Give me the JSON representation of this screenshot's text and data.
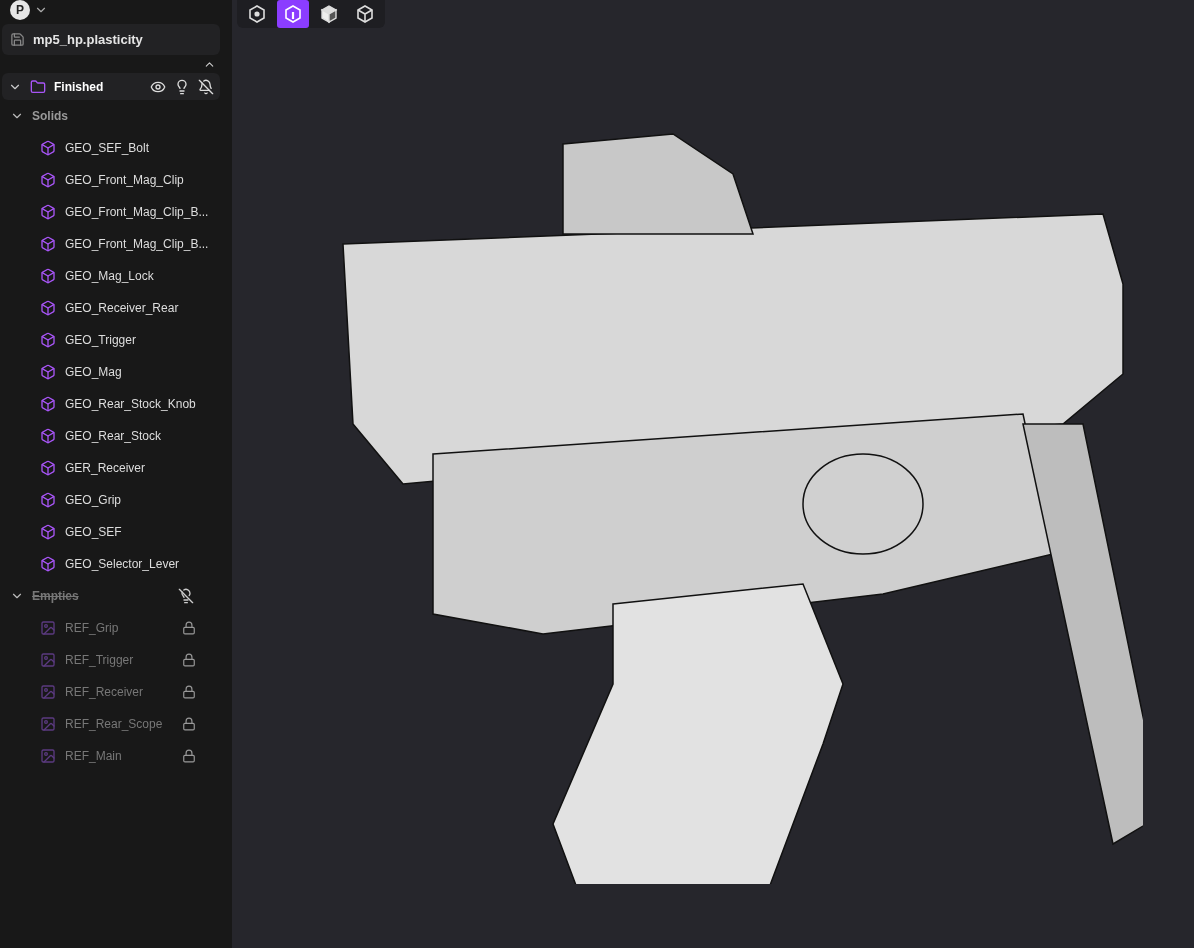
{
  "account": {
    "initial": "P"
  },
  "file": {
    "name": "mp5_hp.plasticity"
  },
  "outliner": {
    "folder": {
      "label": "Finished",
      "expanded": true
    },
    "groups": [
      {
        "label": "Solids",
        "expanded": true,
        "hidden": false,
        "items": [
          {
            "label": "GEO_SEF_Bolt",
            "kind": "solid",
            "locked": false
          },
          {
            "label": "GEO_Front_Mag_Clip",
            "kind": "solid",
            "locked": false
          },
          {
            "label": "GEO_Front_Mag_Clip_B...",
            "kind": "solid",
            "locked": false
          },
          {
            "label": "GEO_Front_Mag_Clip_B...",
            "kind": "solid",
            "locked": false
          },
          {
            "label": "GEO_Mag_Lock",
            "kind": "solid",
            "locked": false
          },
          {
            "label": "GEO_Receiver_Rear",
            "kind": "solid",
            "locked": false
          },
          {
            "label": "GEO_Trigger",
            "kind": "solid",
            "locked": false
          },
          {
            "label": "GEO_Mag",
            "kind": "solid",
            "locked": false
          },
          {
            "label": "GEO_Rear_Stock_Knob",
            "kind": "solid",
            "locked": false
          },
          {
            "label": "GEO_Rear_Stock",
            "kind": "solid",
            "locked": false
          },
          {
            "label": "GER_Receiver",
            "kind": "solid",
            "locked": false
          },
          {
            "label": "GEO_Grip",
            "kind": "solid",
            "locked": false
          },
          {
            "label": "GEO_SEF",
            "kind": "solid",
            "locked": false
          },
          {
            "label": "GEO_Selector_Lever",
            "kind": "solid",
            "locked": false
          }
        ]
      },
      {
        "label": "Empties",
        "expanded": true,
        "hidden": true,
        "items": [
          {
            "label": "REF_Grip",
            "kind": "image",
            "locked": true
          },
          {
            "label": "REF_Trigger",
            "kind": "image",
            "locked": true
          },
          {
            "label": "REF_Receiver",
            "kind": "image",
            "locked": true
          },
          {
            "label": "REF_Rear_Scope",
            "kind": "image",
            "locked": true
          },
          {
            "label": "REF_Main",
            "kind": "image",
            "locked": true
          }
        ]
      }
    ]
  },
  "selection_modes": [
    {
      "kind": "vertex",
      "selected": false
    },
    {
      "kind": "edge",
      "selected": true
    },
    {
      "kind": "face",
      "selected": false
    },
    {
      "kind": "solid",
      "selected": false
    }
  ]
}
